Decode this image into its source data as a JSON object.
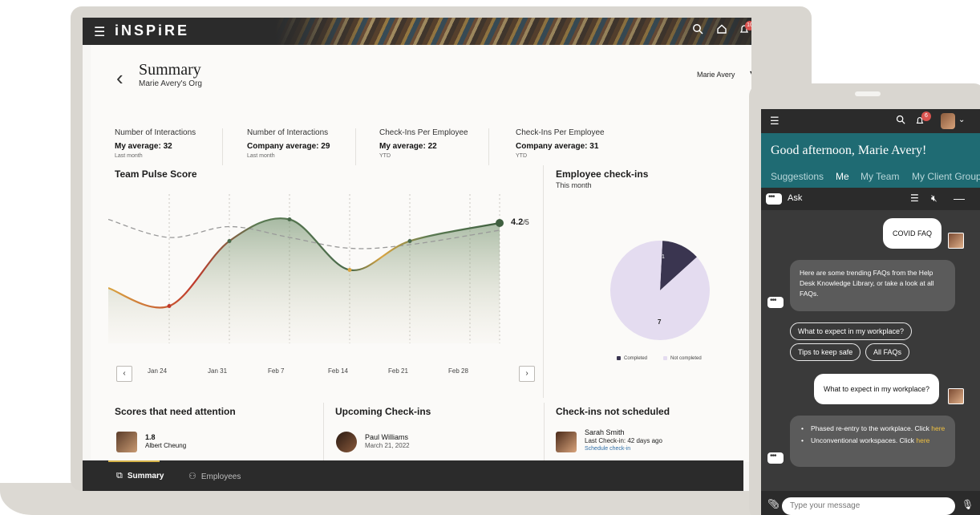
{
  "app": {
    "brand": "iNSPiRE",
    "notif_count": "10"
  },
  "summary": {
    "title": "Summary",
    "subtitle": "Marie Avery's Org",
    "user_selector": "Marie Avery"
  },
  "kpis": [
    {
      "label": "Number of Interactions",
      "value": "My average: 32",
      "period": "Last month"
    },
    {
      "label": "Number of Interactions",
      "value": "Company average: 29",
      "period": "Last month"
    },
    {
      "label": "Check-Ins Per Employee",
      "value": "My average: 22",
      "period": "YTD"
    },
    {
      "label": "Check-Ins Per Employee",
      "value": "Company average: 31",
      "period": "YTD"
    }
  ],
  "pulse": {
    "title": "Team Pulse Score",
    "current_label": "4.2",
    "current_suffix": "/5",
    "prev_button": "‹",
    "next_button": "›"
  },
  "checkins": {
    "title": "Employee check-ins",
    "subtitle": "This month",
    "completed_value": "1",
    "not_completed_value": "7",
    "legend_completed": "Completed",
    "legend_not_completed": "Not completed"
  },
  "chart_data": [
    {
      "type": "line",
      "title": "Team Pulse Score",
      "categories": [
        "Jan 24",
        "Jan 31",
        "Feb 7",
        "Feb 14",
        "Feb 21",
        "Feb 28"
      ],
      "series": [
        {
          "values": [
            2.4,
            1.9,
            3.7,
            4.3,
            2.9,
            3.7,
            4.2
          ]
        },
        {
          "values": [
            4.3,
            3.8,
            4.1,
            3.8,
            3.5,
            3.6,
            4.0
          ]
        }
      ],
      "x_points": [
        "",
        "Jan 24",
        "Jan 31",
        "Feb 7",
        "Feb 14",
        "Feb 21",
        "Feb 28"
      ],
      "colors": {
        "score": "#4a6a4a",
        "low": "#c0392b",
        "mid": "#d9a441",
        "company": "#9a9a9a"
      }
    },
    {
      "type": "pie",
      "title": "Employee check-ins",
      "categories": [
        "Completed",
        "Not completed"
      ],
      "values": [
        1,
        7
      ],
      "colors": [
        "#3a3550",
        "#e4dcf0"
      ]
    }
  ],
  "bottom": {
    "attention": {
      "title": "Scores that need attention",
      "score": "1.8",
      "name": "Albert Cheung"
    },
    "upcoming": {
      "title": "Upcoming Check-ins",
      "name": "Paul Williams",
      "date": "March 21, 2022"
    },
    "not_scheduled": {
      "title": "Check-ins not scheduled",
      "name": "Sarah Smith",
      "last": "Last Check-in: 42 days ago",
      "action": "Schedule check-in"
    }
  },
  "footer": {
    "tab_summary": "Summary",
    "tab_employees": "Employees"
  },
  "phone": {
    "notif_count": "6",
    "greeting": "Good afternoon, Marie Avery!",
    "tabs": [
      "Suggestions",
      "Me",
      "My Team",
      "My Client Group"
    ],
    "ask_label": "Ask",
    "msg_user_1": "COVID FAQ",
    "msg_bot_1": "Here are some trending FAQs from the Help Desk Knowledge Library, or take a look at all FAQs.",
    "chips": [
      "What to expect in my workplace?",
      "Tips to keep safe",
      "All FAQs"
    ],
    "msg_user_2": "What to expect in my workplace?",
    "bullet_1_text": "Phased re-entry to the workplace. Click",
    "bullet_1_link": "here",
    "bullet_2_text": "Unconventional workspaces. Click",
    "bullet_2_link": "here",
    "input_placeholder": "Type your message"
  }
}
